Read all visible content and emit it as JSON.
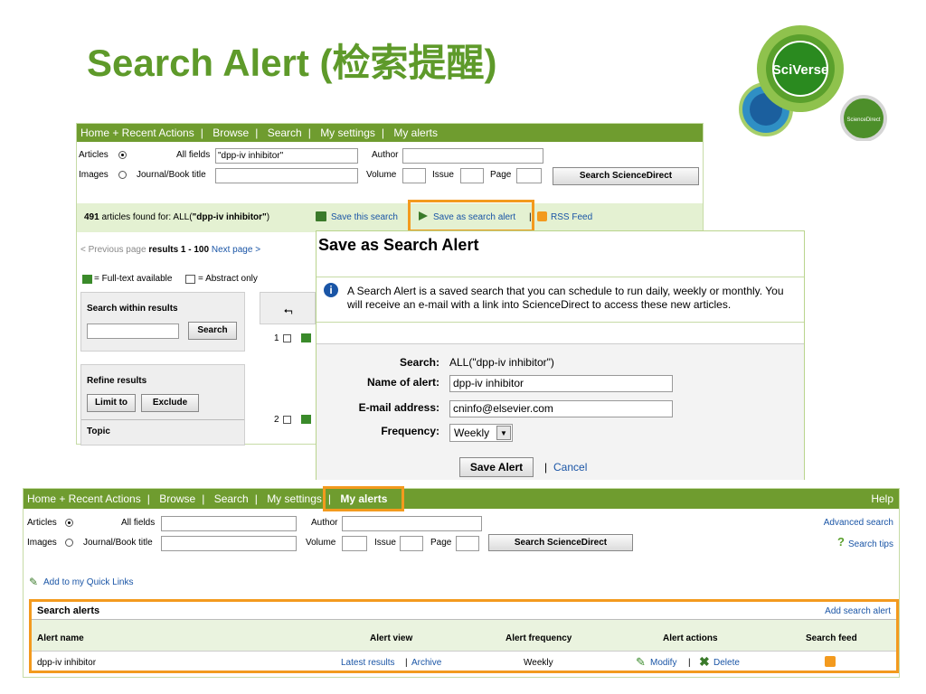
{
  "slide_title": "Search Alert (检索提醒)",
  "logo": {
    "main": "SciVerse",
    "secondary": "ScienceDirect"
  },
  "top_panel": {
    "nav": [
      "Home + Recent Actions",
      "Browse",
      "Search",
      "My settings",
      "My alerts"
    ],
    "search_form": {
      "articles_label": "Articles",
      "images_label": "Images",
      "all_fields_label": "All fields",
      "all_fields_value": "\"dpp-iv inhibitor\"",
      "journal_label": "Journal/Book title",
      "author_label": "Author",
      "volume_label": "Volume",
      "issue_label": "Issue",
      "page_label": "Page",
      "search_button": "Search ScienceDirect"
    },
    "results_bar": {
      "count": "491",
      "text": "articles found for: ALL(",
      "query": "\"dpp-iv inhibitor\"",
      "close": ")",
      "save_search": "Save this search",
      "save_alert": "Save as search alert",
      "rss": "RSS Feed"
    },
    "paging": {
      "prev": "< Previous page",
      "results": "results 1 - 100",
      "next": "Next page >"
    },
    "legend": {
      "full_text": "= Full-text available",
      "abstract": "= Abstract only"
    },
    "sidebar": {
      "search_within": "Search within results",
      "search_button": "Search",
      "refine": "Refine results",
      "limit": "Limit to",
      "exclude": "Exclude",
      "topic": "Topic"
    },
    "result_numbers": [
      "1",
      "2"
    ]
  },
  "dialog": {
    "title": "Save as Search Alert",
    "info": "A Search Alert is a saved search that you can schedule to run daily, weekly or monthly. You will receive an e-mail with a link into ScienceDirect to access these new articles.",
    "search_label": "Search:",
    "search_value": "ALL(\"dpp-iv inhibitor\")",
    "name_label": "Name of alert:",
    "name_value": "dpp-iv inhibitor",
    "email_label": "E-mail address:",
    "email_value": "cninfo@elsevier.com",
    "frequency_label": "Frequency:",
    "frequency_value": "Weekly",
    "save_button": "Save Alert",
    "cancel": "Cancel"
  },
  "bottom_panel": {
    "nav": [
      "Home + Recent Actions",
      "Browse",
      "Search",
      "My settings",
      "My alerts"
    ],
    "help": "Help",
    "search_form": {
      "articles_label": "Articles",
      "images_label": "Images",
      "all_fields_label": "All fields",
      "journal_label": "Journal/Book title",
      "author_label": "Author",
      "volume_label": "Volume",
      "issue_label": "Issue",
      "page_label": "Page",
      "search_button": "Search ScienceDirect",
      "advanced": "Advanced search",
      "tips": "Search tips"
    },
    "quick_links": "Add to my Quick Links",
    "alerts_table": {
      "title": "Search alerts",
      "add": "Add search alert",
      "headers": [
        "Alert name",
        "Alert view",
        "Alert frequency",
        "Alert actions",
        "Search feed"
      ],
      "row": {
        "name": "dpp-iv inhibitor",
        "latest": "Latest results",
        "archive": "Archive",
        "frequency": "Weekly",
        "modify": "Modify",
        "delete": "Delete"
      }
    }
  },
  "colors": {
    "brand_green": "#6f9c2f",
    "title_green": "#5e9a2a",
    "highlight_orange": "#f39a1e",
    "link_blue": "#1a55a6"
  }
}
